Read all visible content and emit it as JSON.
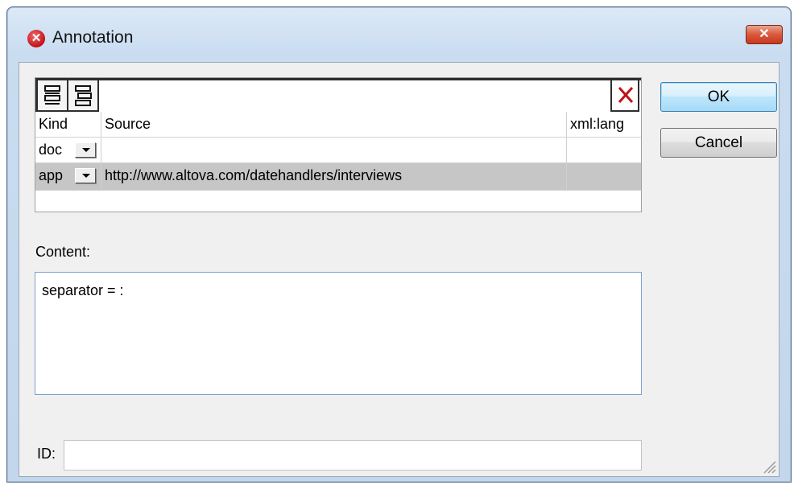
{
  "window": {
    "title": "Annotation",
    "app_icon": "altova-x-icon",
    "close_icon": "close-icon"
  },
  "grid": {
    "toolbar": {
      "buttons": [
        "insert-row-icon",
        "append-row-icon"
      ],
      "delete_icon": "delete-x-icon"
    },
    "columns": [
      "Kind",
      "Source",
      "xml:lang"
    ],
    "rows": [
      {
        "kind": "doc",
        "source": "",
        "lang": ""
      },
      {
        "kind": "app",
        "source": "http://www.altova.com/datehandlers/interviews",
        "lang": ""
      }
    ]
  },
  "content": {
    "label": "Content:",
    "value": "separator = :"
  },
  "id": {
    "label": "ID:",
    "value": ""
  },
  "buttons": {
    "ok": "OK",
    "cancel": "Cancel"
  },
  "colors": {
    "accent": "#3c7fb1",
    "delete": "#c0121a",
    "selected_row": "#c6c6c6"
  }
}
